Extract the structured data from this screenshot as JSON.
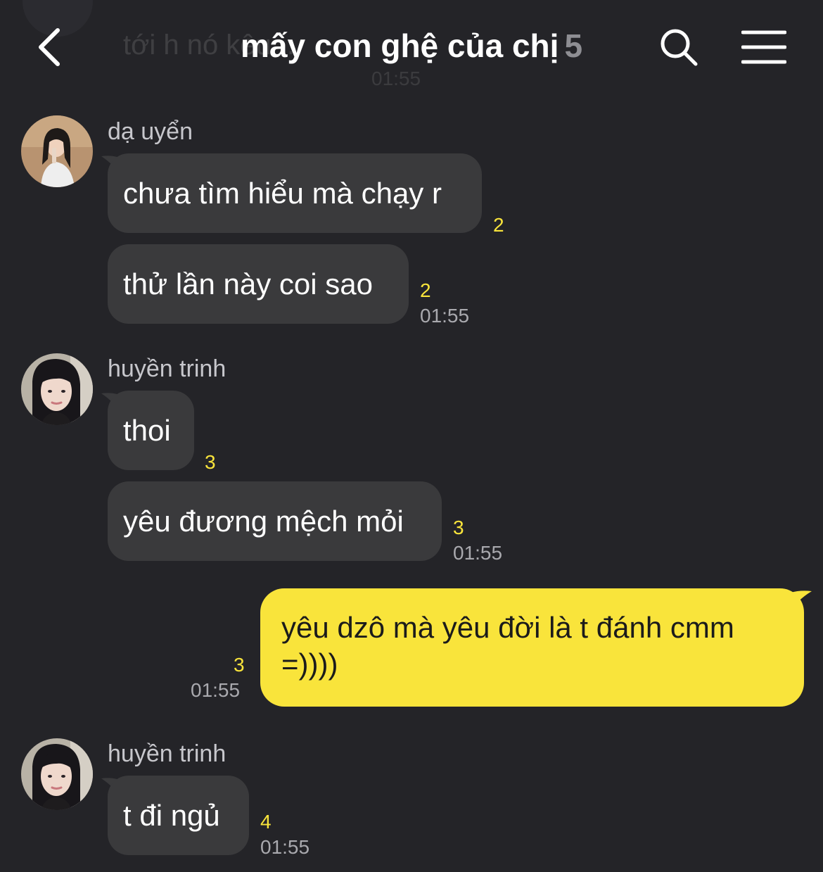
{
  "header": {
    "title": "mấy con ghệ của chị",
    "member_count": "5",
    "ghost_preview_text": "tới h nó kêu ...",
    "ghost_preview_time": "01:55"
  },
  "messages": [
    {
      "sender": "dạ uyển",
      "items": [
        {
          "text": "chưa tìm hiểu mà chạy r",
          "unread": "2"
        },
        {
          "text": "thử lần này coi sao",
          "unread": "2",
          "time": "01:55"
        }
      ]
    },
    {
      "sender": "huyền trinh",
      "items": [
        {
          "text": "thoi",
          "unread": "3"
        },
        {
          "text": "yêu đương mệch mỏi",
          "unread": "3",
          "time": "01:55"
        }
      ]
    },
    {
      "outgoing": true,
      "items": [
        {
          "line1": "yêu dzô mà yêu đời là t đánh cmm",
          "line2": "=))))",
          "unread": "3",
          "time": "01:55"
        }
      ]
    },
    {
      "sender": "huyền trinh",
      "items": [
        {
          "text": "t đi ngủ",
          "unread": "4",
          "time": "01:55"
        }
      ]
    }
  ],
  "colors": {
    "background": "#242428",
    "incoming_bubble": "#3a3a3c",
    "outgoing_bubble": "#f9e43b",
    "unread_count": "#f9e43b"
  },
  "icons": [
    "chevron-left-icon",
    "search-icon",
    "menu-icon"
  ]
}
